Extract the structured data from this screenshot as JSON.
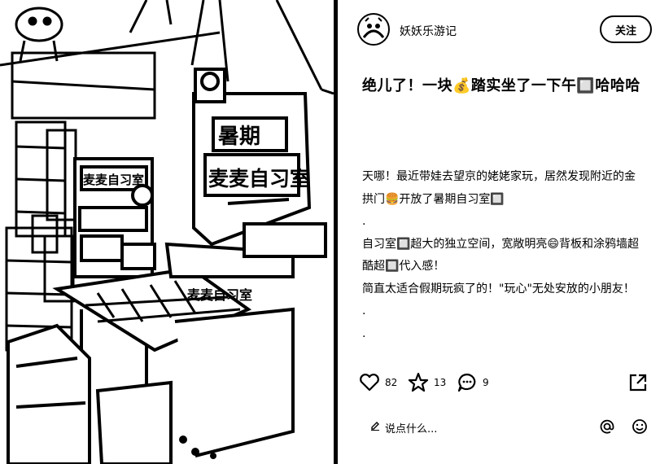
{
  "author": {
    "name": "妖妖乐游记",
    "avatar_icon": "cartoon-avatar-icon"
  },
  "follow_button": {
    "label": "关注"
  },
  "post": {
    "title": "绝儿了！一块💰踏实坐了一下午🔲哈哈哈",
    "body_lines": [
      "天哪！最近带娃去望京的姥姥家玩，居然发现附近的金拱门🍔开放了暑期自习室🔲",
      ".",
      "自习室🔲超大的独立空间，宽敞明亮😄背板和涂鸦墙超酷超🔲代入感！",
      "简直太适合假期玩疯了的！\"玩心\"无处安放的小朋友！",
      ".",
      "."
    ]
  },
  "image": {
    "sign_small": "麦麦自习室",
    "sign_big_top": "暑期",
    "sign_big_main": "麦麦自习室",
    "table_sign": "麦麦自习室"
  },
  "stats": {
    "likes": "82",
    "stars": "13",
    "comments": "9"
  },
  "comment_box": {
    "placeholder": "说点什么..."
  },
  "icons": {
    "like": "heart-icon",
    "collect": "star-icon",
    "comment": "chat-bubble-icon",
    "share": "share-icon",
    "mention": "at-icon",
    "emoji": "smiley-icon",
    "edit": "pencil-icon"
  }
}
